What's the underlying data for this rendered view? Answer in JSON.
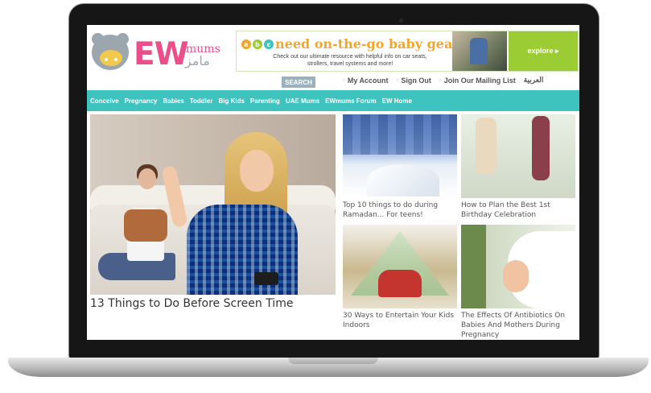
{
  "logo": {
    "brand_text": "EW",
    "sub_text": "mums",
    "arabic_text": "مامز"
  },
  "ad": {
    "badges": [
      "a",
      "b",
      "c"
    ],
    "headline": "need on-the-go baby gear?",
    "body": "Check out our ultimate resource with helpful info on car seats, strollers, travel systems and more!",
    "cta": "explore ▸"
  },
  "search": {
    "button_label": "SEARCH"
  },
  "user_links": {
    "my_account": "My Account",
    "sign_out": "Sign Out",
    "mailing_list": "Join Our Mailing List",
    "language": "العربية"
  },
  "nav": {
    "items": [
      "Conceive",
      "Pregnancy",
      "Babies",
      "Toddler",
      "Big Kids",
      "Parenting",
      "UAE Mums",
      "EWmums Forum",
      "EW Home"
    ]
  },
  "hero": {
    "title": "13 Things to Do Before Screen Time"
  },
  "cards": [
    {
      "title": "Top 10 things to do during Ramadan... For teens!"
    },
    {
      "title": "How to Plan the Best 1st Birthday Celebration"
    },
    {
      "title": "30 Ways to Entertain Your Kids Indoors"
    },
    {
      "title": "The Effects Of Antibiotics On Babies And Mothers During Pregnancy"
    }
  ],
  "colors": {
    "nav_bg": "#3ec3bf",
    "brand_pink": "#ea4f8b",
    "ad_accent": "#f0a72f",
    "cta_green": "#9ccc34",
    "bear_grey": "#9ba7ad"
  },
  "icons": {
    "user": "user-icon",
    "sign_out": "sign-out-icon",
    "mail": "mail-icon"
  }
}
